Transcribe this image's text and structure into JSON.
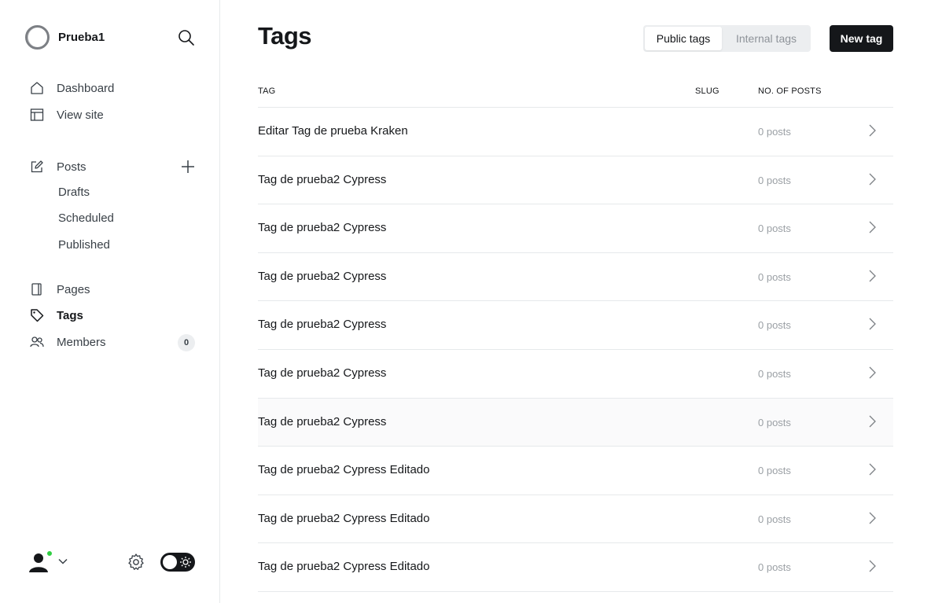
{
  "sidebar": {
    "site_name": "Prueba1",
    "nav": {
      "dashboard": "Dashboard",
      "view_site": "View site",
      "posts": "Posts",
      "drafts": "Drafts",
      "scheduled": "Scheduled",
      "published": "Published",
      "pages": "Pages",
      "tags": "Tags",
      "members": "Members"
    },
    "members_count": "0"
  },
  "header": {
    "title": "Tags",
    "public_tab": "Public tags",
    "internal_tab": "Internal tags",
    "new_tag": "New tag"
  },
  "table": {
    "columns": {
      "tag": "TAG",
      "slug": "SLUG",
      "posts": "NO. OF POSTS"
    },
    "rows": [
      {
        "name": "Editar Tag de prueba Kraken",
        "count": "0 posts"
      },
      {
        "name": "Tag de prueba2 Cypress",
        "count": "0 posts"
      },
      {
        "name": "Tag de prueba2 Cypress",
        "count": "0 posts"
      },
      {
        "name": "Tag de prueba2 Cypress",
        "count": "0 posts"
      },
      {
        "name": "Tag de prueba2 Cypress",
        "count": "0 posts"
      },
      {
        "name": "Tag de prueba2 Cypress",
        "count": "0 posts"
      },
      {
        "name": "Tag de prueba2 Cypress",
        "count": "0 posts"
      },
      {
        "name": "Tag de prueba2 Cypress Editado",
        "count": "0 posts"
      },
      {
        "name": "Tag de prueba2 Cypress Editado",
        "count": "0 posts"
      },
      {
        "name": "Tag de prueba2 Cypress Editado",
        "count": "0 posts"
      }
    ]
  },
  "colors": {
    "accent_dark": "#15171a",
    "online_dot": "#30cf43",
    "muted_text": "#9ba0a5"
  }
}
